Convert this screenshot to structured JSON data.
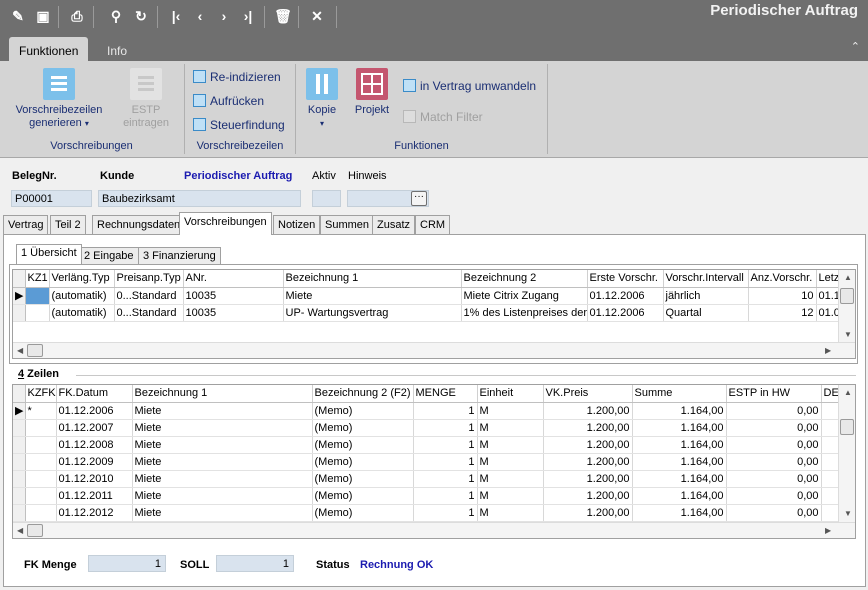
{
  "window": {
    "title": "Periodischer Auftrag"
  },
  "ribbon_tabs": [
    "Funktionen",
    "Info"
  ],
  "ribbon": {
    "btn_vorschreibezeilen": "Vorschreibezeilen generieren",
    "btn_estp": "ESTP eintragen",
    "group1": "Vorschreibungen",
    "btn_reindizieren": "Re-indizieren",
    "btn_aufruecken": "Aufrücken",
    "btn_steuerfindung": "Steuerfindung",
    "group2": "Vorschreibezeilen",
    "btn_kopie": "Kopie",
    "btn_projekt": "Projekt",
    "btn_vertrag": "in Vertrag umwandeln",
    "btn_match": "Match Filter",
    "group3": "Funktionen"
  },
  "header": {
    "belegnr_label": "BelegNr.",
    "kunde_label": "Kunde",
    "type_label": "Periodischer Auftrag",
    "aktiv_label": "Aktiv",
    "hinweis_label": "Hinweis",
    "belegnr": "P00001",
    "kunde": "Baubezirksamt",
    "dots": "···"
  },
  "page_tabs": [
    "Vertrag",
    "Teil 2",
    "Rechnungsdaten",
    "Vorschreibungen",
    "Notizen",
    "Summen",
    "Zusatz",
    "CRM"
  ],
  "sub_tabs": [
    "1 Übersicht",
    "2 Eingabe",
    "3 Finanzierung"
  ],
  "grid1": {
    "columns": [
      "KZ1",
      "Verläng.Typ",
      "Preisanp.Typ",
      "ANr.",
      "Bezeichnung 1",
      "Bezeichnung 2",
      "Erste Vorschr.",
      "Vorschr.Intervall",
      "Anz.Vorschr.",
      "Letz"
    ],
    "rows": [
      [
        "",
        "(automatik)",
        "0...Standard",
        "10035",
        "Miete",
        "Miete Citrix Zugang",
        "01.12.2006",
        "jährlich",
        "10",
        "01.1"
      ],
      [
        "",
        "(automatik)",
        "0...Standard",
        "10035",
        "UP- Wartungsvertrag",
        "1% des Listenpreises der",
        "01.12.2006",
        "Quartal",
        "12",
        "01.0"
      ]
    ]
  },
  "section2": {
    "title_num": "4",
    "title_rest": " Zeilen"
  },
  "grid2": {
    "columns": [
      "KZFK",
      "FK.Datum",
      "Bezeichnung 1",
      "Bezeichnung 2 (F2)",
      "MENGE",
      "Einheit",
      "VK.Preis",
      "Summe",
      "ESTP in HW",
      "DE"
    ],
    "rows": [
      [
        "*",
        "01.12.2006",
        "Miete",
        "(Memo)",
        "1",
        "M",
        "1.200,00",
        "1.164,00",
        "0,00",
        ""
      ],
      [
        "",
        "01.12.2007",
        "Miete",
        "(Memo)",
        "1",
        "M",
        "1.200,00",
        "1.164,00",
        "0,00",
        ""
      ],
      [
        "",
        "01.12.2008",
        "Miete",
        "(Memo)",
        "1",
        "M",
        "1.200,00",
        "1.164,00",
        "0,00",
        ""
      ],
      [
        "",
        "01.12.2009",
        "Miete",
        "(Memo)",
        "1",
        "M",
        "1.200,00",
        "1.164,00",
        "0,00",
        ""
      ],
      [
        "",
        "01.12.2010",
        "Miete",
        "(Memo)",
        "1",
        "M",
        "1.200,00",
        "1.164,00",
        "0,00",
        ""
      ],
      [
        "",
        "01.12.2011",
        "Miete",
        "(Memo)",
        "1",
        "M",
        "1.200,00",
        "1.164,00",
        "0,00",
        ""
      ],
      [
        "",
        "01.12.2012",
        "Miete",
        "(Memo)",
        "1",
        "M",
        "1.200,00",
        "1.164,00",
        "0,00",
        ""
      ]
    ]
  },
  "footer": {
    "fk_menge_label": "FK Menge",
    "fk_menge": "1",
    "soll_label": "SOLL",
    "soll": "1",
    "status_label": "Status",
    "status_value": "Rechnung OK"
  },
  "colors": {
    "titlebar": "#6f6f6f",
    "ribbon": "#d4d4d4",
    "accent_blue": "#1b1bb0",
    "field": "#d9e3ee"
  }
}
